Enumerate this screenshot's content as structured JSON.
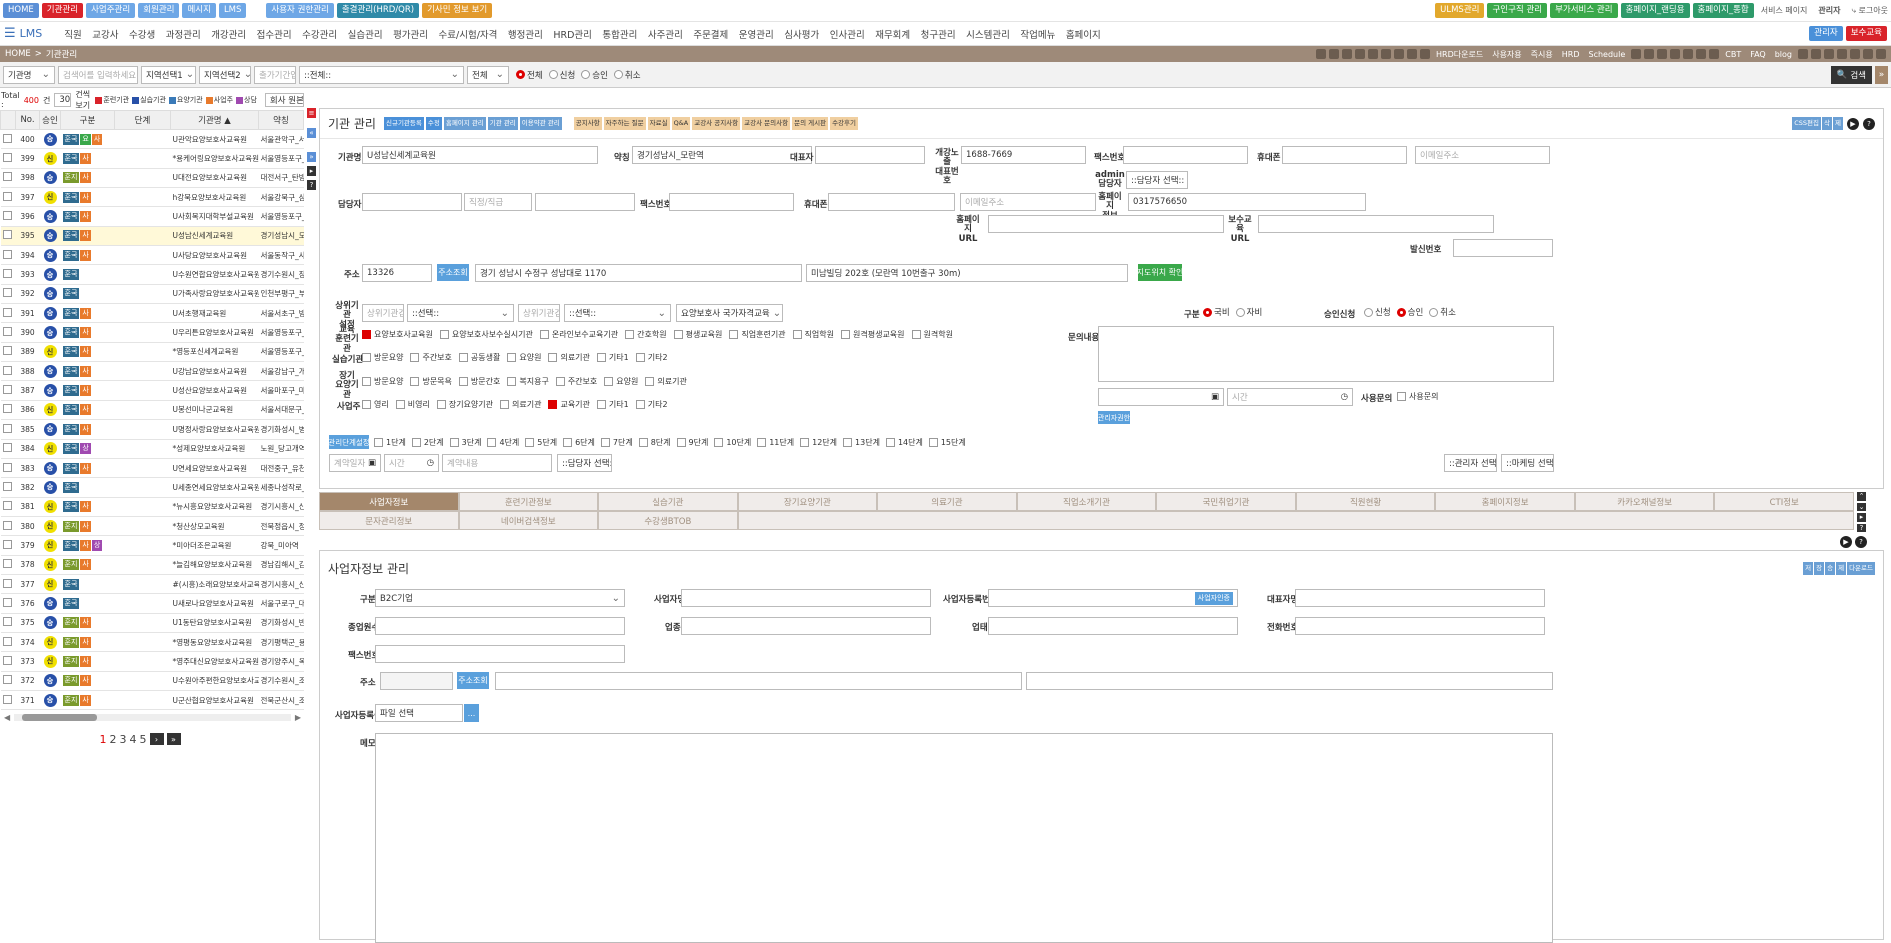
{
  "topbar": {
    "left": [
      {
        "label": "HOME",
        "color": "#5b8fd6"
      },
      {
        "label": "기관관리",
        "color": "#d9232a"
      },
      {
        "label": "사업주관리",
        "color": "#6ea7e6"
      },
      {
        "label": "회원관리",
        "color": "#6ea7e6"
      },
      {
        "label": "메시지",
        "color": "#6ea7e6"
      },
      {
        "label": "LMS",
        "color": "#6ea7e6"
      }
    ],
    "mid": [
      {
        "label": "사용자 권한관리",
        "color": "#6ea7e6"
      },
      {
        "label": "출결관리(HRD/QR)",
        "color": "#2f8aa8"
      },
      {
        "label": "기사민 정보 보기",
        "color": "#e29a2c"
      }
    ],
    "right": [
      {
        "label": "ULMS관리",
        "color": "#e2a82c"
      },
      {
        "label": "구인구직 관리",
        "color": "#3aa84a"
      },
      {
        "label": "부가서비스 관리",
        "color": "#3aa84a"
      },
      {
        "label": "홈페이지_랜딩용",
        "color": "#2e9a6a"
      },
      {
        "label": "홈페이지_통합",
        "color": "#2e9a6a"
      }
    ],
    "service_page": "서비스 페이지",
    "admin": "관리자",
    "logout": "로그아웃"
  },
  "menu": {
    "logo": "LMS",
    "items": [
      "직원",
      "교강사",
      "수강생",
      "과정관리",
      "개강관리",
      "접수관리",
      "수강관리",
      "실습관리",
      "평가관리",
      "수료/시험/자격",
      "행정관리",
      "HRD관리",
      "통합관리",
      "사주관리",
      "주문결제",
      "운영관리",
      "심사평가",
      "인사관리",
      "재무회계",
      "청구관리",
      "시스템관리",
      "작업메뉴",
      "홈페이지"
    ],
    "right": [
      {
        "label": "관리자",
        "color": "#4a90d9"
      },
      {
        "label": "보수교육",
        "color": "#d9232a"
      }
    ]
  },
  "breadcrumb": {
    "home": "HOME",
    "sep": ">",
    "current": "기관관리"
  },
  "toolbar_links": [
    "HRD다운로드",
    "사용자용",
    "즉시용",
    "HRD",
    "Schedule",
    "CBT",
    "FAQ",
    "blog"
  ],
  "search": {
    "field": "기관명",
    "keyword_placeholder": "검색어를 입력하세요.",
    "region1": "지역선택1",
    "region2": "지역선택2",
    "date_placeholder": "출가기간입력",
    "type": "::전체::",
    "filter": "전체",
    "radios": [
      "전체",
      "신청",
      "승인",
      "취소"
    ],
    "selected_radio": "전체",
    "search_btn": "검색"
  },
  "list": {
    "total_label": "Total :",
    "total": "400",
    "total_unit": "건",
    "per_page": "30",
    "per_page_label": "건씩 보기",
    "legend": [
      {
        "label": "훈련기관",
        "color": "#d9232a"
      },
      {
        "label": "실습기관",
        "color": "#2850a8"
      },
      {
        "label": "요양기관",
        "color": "#3a7ab8"
      },
      {
        "label": "사업주",
        "color": "#e87a2c"
      },
      {
        "label": "상담",
        "color": "#a04ab0"
      }
    ],
    "sort": "회사 원본방송",
    "columns": [
      "No.",
      "승인",
      "구분",
      "단계",
      "기관명 ▲",
      "약칭"
    ],
    "rows": [
      {
        "no": "400",
        "st": "승",
        "tags": [
          "훈국",
          "요",
          "사"
        ],
        "name": "U관악요양보호사교육원",
        "abbr": "서울관악구_서선"
      },
      {
        "no": "399",
        "st": "신",
        "tags": [
          "훈국",
          "사"
        ],
        "name": "*용케어링요양보호사교육원",
        "abbr": "서울영등포구_수신"
      },
      {
        "no": "398",
        "st": "승",
        "tags": [
          "훈지",
          "사"
        ],
        "name": "U대전요양보호사교육원",
        "abbr": "대전서구_탄방"
      },
      {
        "no": "397",
        "st": "신",
        "tags": [
          "훈국",
          "사"
        ],
        "name": "h강북요양보호사교육원",
        "abbr": "서울강북구_삼양"
      },
      {
        "no": "396",
        "st": "승",
        "tags": [
          "훈국",
          "사"
        ],
        "name": "U사회복지대학부설교육원",
        "abbr": "서울영등포구_당"
      },
      {
        "no": "395",
        "st": "승",
        "tags": [
          "훈국",
          "사"
        ],
        "name": "U성남신세계교육원",
        "abbr": "경기성남시_모란",
        "hl": true
      },
      {
        "no": "394",
        "st": "승",
        "tags": [
          "훈국",
          "사"
        ],
        "name": "U사당요양보호사교육원",
        "abbr": "서울동작구_사당"
      },
      {
        "no": "393",
        "st": "승",
        "tags": [
          "훈국"
        ],
        "name": "U수원연합요양보호사교육원",
        "abbr": "경기수원시_장안"
      },
      {
        "no": "392",
        "st": "승",
        "tags": [
          "훈국"
        ],
        "name": "U가족사랑요양보호사교육원",
        "abbr": "인천부평구_부평"
      },
      {
        "no": "391",
        "st": "승",
        "tags": [
          "훈국",
          "사"
        ],
        "name": "U서초행재교육원",
        "abbr": "서울서초구_방배"
      },
      {
        "no": "390",
        "st": "승",
        "tags": [
          "훈국",
          "사"
        ],
        "name": "U우리튼요양보호사교육원",
        "abbr": "서울영등포구_신"
      },
      {
        "no": "389",
        "st": "신",
        "tags": [
          "훈국",
          "사"
        ],
        "name": "*영등포신세계교육원",
        "abbr": "서울영등포구_신"
      },
      {
        "no": "388",
        "st": "승",
        "tags": [
          "훈국",
          "사"
        ],
        "name": "U강남요양보호사교육원",
        "abbr": "서울강남구_개포"
      },
      {
        "no": "387",
        "st": "승",
        "tags": [
          "훈국",
          "사"
        ],
        "name": "U성산요양보호사교육원",
        "abbr": "서울마포구_마포"
      },
      {
        "no": "386",
        "st": "신",
        "tags": [
          "훈국",
          "사"
        ],
        "name": "U봉선미나군교육원",
        "abbr": "서울서대문구_봉"
      },
      {
        "no": "385",
        "st": "승",
        "tags": [
          "훈국",
          "사"
        ],
        "name": "U명정사랑요양보호사교육원",
        "abbr": "경기화성시_병점"
      },
      {
        "no": "384",
        "st": "신",
        "tags": [
          "훈국",
          "상"
        ],
        "name": "*성제요양보호사교육원",
        "abbr": "노원_당고개역"
      },
      {
        "no": "383",
        "st": "승",
        "tags": [
          "훈국",
          "사"
        ],
        "name": "U연세요양보호사교육원",
        "abbr": "대전중구_유천"
      },
      {
        "no": "382",
        "st": "승",
        "tags": [
          "훈국"
        ],
        "name": "U세종연세요양보호사교육원",
        "abbr": "세종나성작로_나"
      },
      {
        "no": "381",
        "st": "신",
        "tags": [
          "훈국",
          "사"
        ],
        "name": "*뉴시흥요양보호사교육원",
        "abbr": "경기시흥시_신천"
      },
      {
        "no": "380",
        "st": "신",
        "tags": [
          "훈지",
          "사"
        ],
        "name": "*청산상모교육원",
        "abbr": "전북정읍시_정읍"
      },
      {
        "no": "379",
        "st": "신",
        "tags": [
          "훈국",
          "사",
          "상"
        ],
        "name": "*미아더조은교육원",
        "abbr": "강북_미아역"
      },
      {
        "no": "378",
        "st": "신",
        "tags": [
          "훈지",
          "사"
        ],
        "name": "*늘김해요양보호사교육원",
        "abbr": "경남김해시_김해"
      },
      {
        "no": "377",
        "st": "신",
        "tags": [
          "훈국"
        ],
        "name": "#(시흥)소래요양보호사교육원",
        "abbr": "경기시흥시_신천"
      },
      {
        "no": "376",
        "st": "승",
        "tags": [
          "훈국"
        ],
        "name": "U새로나요양보호사교육원",
        "abbr": "서울구로구_대림"
      },
      {
        "no": "375",
        "st": "승",
        "tags": [
          "훈지",
          "사"
        ],
        "name": "U1동탄요양보호사교육원",
        "abbr": "경기화성시_반송"
      },
      {
        "no": "374",
        "st": "신",
        "tags": [
          "훈지",
          "사"
        ],
        "name": "*영평동요양보호사교육원",
        "abbr": "경기평택군_용이"
      },
      {
        "no": "373",
        "st": "신",
        "tags": [
          "훈지",
          "사"
        ],
        "name": "*영주대신요양보호사교육원",
        "abbr": "경기양주시_옥정"
      },
      {
        "no": "372",
        "st": "승",
        "tags": [
          "훈지",
          "사"
        ],
        "name": "U수원아주편한요양보호사교육원",
        "abbr": "경기수원시_조원"
      },
      {
        "no": "371",
        "st": "승",
        "tags": [
          "훈지",
          "사"
        ],
        "name": "U군산협요양보호사교육원",
        "abbr": "전북군산시_조촌"
      }
    ],
    "pages": [
      "1",
      "2",
      "3",
      "4",
      "5"
    ]
  },
  "vstrip": [
    {
      "l": "≡",
      "c": "#d9232a"
    },
    {
      "l": "«",
      "c": "#5b8fd6"
    },
    {
      "l": "»",
      "c": "#5b8fd6"
    },
    {
      "l": "▸",
      "c": "#333"
    },
    {
      "l": "?",
      "c": "#333"
    }
  ],
  "org": {
    "title": "기관 관리",
    "title_btns_blue": [
      "신규기관등록",
      "수정"
    ],
    "title_btns": [
      "홈페이지 관리",
      "기관 관리",
      "이용약관 관리"
    ],
    "title_btns_tan": [
      "공지사항",
      "자주하는 질문",
      "자료실",
      "Q&A",
      "교강사 공지사항",
      "교강사 문의사항",
      "문의 게시판",
      "수강후기"
    ],
    "right_btns": [
      "CSS편집",
      "삭",
      "제"
    ],
    "fields": {
      "name_label": "기관명",
      "name": "U성남신세계교육원",
      "abbr_label": "약칭",
      "abbr": "경기성남시_모란역",
      "ceo_label": "대표자",
      "tel_label": "개강노출\n대표번호",
      "tel": "1688-7669",
      "fax_label": "팩스번호",
      "mobile_label": "휴대폰",
      "email_ph": "이메일주소",
      "admin_label": "admin\n담당자",
      "admin_sel": "::담당자 선택::",
      "staff_label": "담당자",
      "staff_pos_ph": "직정/직급",
      "staff_fax_label": "팩스번호",
      "staff_mobile_label": "휴대폰",
      "staff_email_ph": "이메일주소",
      "hp_label": "홈페이지\n정보",
      "hp_val": "0317576650",
      "url_label": "홈페이지\nURL",
      "edu_url_label": "보수교육\nURL",
      "sender_label": "발신번호",
      "addr_label": "주소",
      "zip": "13326",
      "addr_btn": "주소조회",
      "addr1": "경기 성남시 수정구 성남대로 1170",
      "addr2": "미남빌딩 202호 (모란역 10번출구 30m)",
      "map_btn": "지도위치 확인"
    },
    "parent_label": "상위기관\n설정",
    "parent_ph1": "상위기관검색",
    "parent_sel1": "::선택::",
    "parent_ph2": "상위기관검색",
    "parent_sel2": "::선택::",
    "parent_sel3": "요양보호사 국가자격교육",
    "edu_label": "교육\n훈련기관",
    "edu_opts": [
      {
        "l": "요양보호사교육원",
        "on": true
      },
      {
        "l": "요양보호사보수실시기관"
      },
      {
        "l": "온라인보수교육기관"
      },
      {
        "l": "간호학원"
      },
      {
        "l": "평생교육원"
      },
      {
        "l": "직업훈련기관"
      },
      {
        "l": "직업학원"
      },
      {
        "l": "원격평생교육원"
      },
      {
        "l": "원격학원"
      }
    ],
    "practice_label": "실습기관",
    "practice_opts": [
      "방문요양",
      "주간보호",
      "공동생활",
      "요양원",
      "의료기관",
      "기타1",
      "기타2"
    ],
    "ltc_label": "장기\n요양기관",
    "ltc_opts": [
      "방문요양",
      "방문목욕",
      "방문간호",
      "복지용구",
      "주간보호",
      "요양원",
      "의료기관"
    ],
    "biz_label": "사업주",
    "biz_opts": [
      {
        "l": "영리"
      },
      {
        "l": "비영리"
      },
      {
        "l": "장기요양기관"
      },
      {
        "l": "의료기관"
      },
      {
        "l": "교육기관",
        "on": true
      },
      {
        "l": "기타1"
      },
      {
        "l": "기타2"
      }
    ],
    "class_label": "구분",
    "class_opts": [
      "국비",
      "자비"
    ],
    "class_sel": "국비",
    "approve_label": "승인신청",
    "approve_opts": [
      "신청",
      "승인",
      "취소"
    ],
    "approve_sel": "승인",
    "inquiry_label": "문의내용",
    "time_ph": "시간",
    "use_label": "사용문의",
    "use_opt": "사용문의",
    "admin_btn": "관리자권한",
    "stage_btn": "관리단계설정",
    "stages": [
      "1단계",
      "2단계",
      "3단계",
      "4단계",
      "5단계",
      "6단계",
      "7단계",
      "8단계",
      "9단계",
      "10단계",
      "11단계",
      "12단계",
      "13단계",
      "14단계",
      "15단계"
    ],
    "date_ph": "계약일자",
    "time2_ph": "시간",
    "memo_ph": "계약내용",
    "staff_sel": "::담당자 선택::",
    "mgr_sel": "::관리자 선택::",
    "mkt_sel": "::마케팅 선택::"
  },
  "tabs": {
    "row1": [
      "사업자정보",
      "훈련기관정보",
      "실습기관",
      "장기요양기관",
      "의료기관",
      "직업소개기관",
      "국민취업기관",
      "직원현황",
      "홈페이지정보",
      "카카오채널정보",
      "CTI정보"
    ],
    "row2": [
      "문자관리정보",
      "네이버검색정보",
      "수강생BTOB"
    ],
    "active": "사업자정보"
  },
  "bizinfo": {
    "title": "사업자정보 관리",
    "right_btns": [
      "저",
      "장",
      "승",
      "제",
      "다운로드"
    ],
    "type_label": "구분",
    "type_val": "B2C기업",
    "name_label": "사업자명",
    "regno_label": "사업자등록번호",
    "regno_btn": "사업자인증",
    "ceo_label": "대표자명",
    "emp_label": "종업원수",
    "industry_label": "업종",
    "biz_label": "업태",
    "phone_label": "전화번호",
    "fax_label": "팩스번호",
    "addr_label": "주소",
    "addr_btn": "주소조회",
    "cert_label": "사업자등록증",
    "file_ph": "파일 선택",
    "file_btn": "...",
    "memo_label": "메모"
  }
}
